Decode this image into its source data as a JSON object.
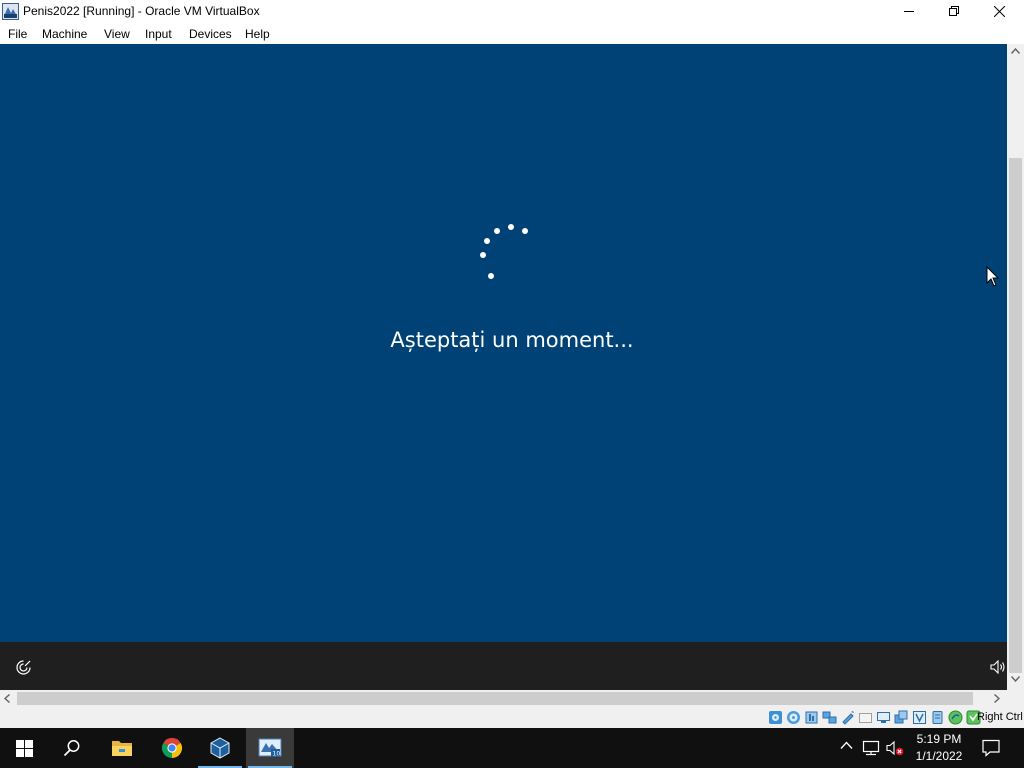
{
  "window": {
    "title": "Penis2022 [Running] - Oracle VM VirtualBox",
    "icon": "virtualbox-icon",
    "controls": [
      "minimize-icon",
      "maximize-icon",
      "close-icon"
    ]
  },
  "menu": {
    "items": [
      {
        "label": "File"
      },
      {
        "label": "Machine"
      },
      {
        "label": "View"
      },
      {
        "label": "Input"
      },
      {
        "label": "Devices"
      },
      {
        "label": "Help"
      }
    ]
  },
  "guest": {
    "message": "Așteptați un moment...",
    "background_color": "#004275",
    "bottom_bar_color": "#1f1f1f",
    "icons": [
      "ease-of-access-icon",
      "volume-icon",
      "loading-spinner",
      "mouse-pointer-icon"
    ]
  },
  "statusbar": {
    "host_key": "Right Ctrl",
    "icons": [
      "hard-disk-icon",
      "optical-drive-icon",
      "audio-icon",
      "network-icon",
      "usb-icon",
      "shared-folders-icon",
      "display-icon",
      "video-capture-icon",
      "recording-icon",
      "virtualization-icon",
      "mouse-integration-icon",
      "keyboard-icon"
    ]
  },
  "taskbar": {
    "apps": [
      {
        "name": "start-icon"
      },
      {
        "name": "search-icon"
      },
      {
        "name": "file-explorer-icon"
      },
      {
        "name": "chrome-icon"
      },
      {
        "name": "virtualbox-manager-icon"
      },
      {
        "name": "virtualbox-vm-icon",
        "active": true
      }
    ],
    "tray_icons": [
      "show-hidden-icons-chevron",
      "network-icon",
      "volume-muted-icon",
      "action-center-icon"
    ],
    "clock": {
      "time": "5:19 PM",
      "date": "1/1/2022"
    },
    "accent_color": "#76b9ed"
  }
}
